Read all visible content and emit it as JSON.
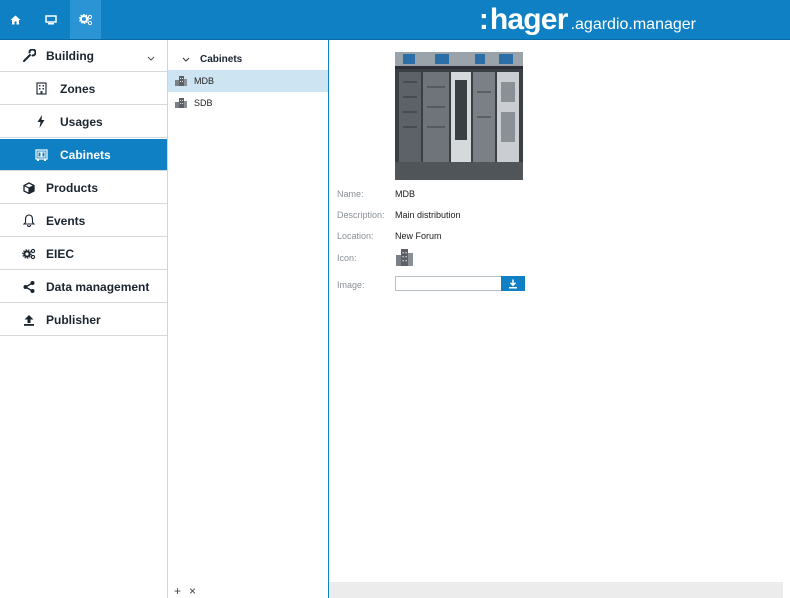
{
  "brand": {
    "colon": ":",
    "name": "hager",
    "product": ".agardio.manager"
  },
  "topbar": {
    "buttons": [
      {
        "icon": "home-icon",
        "active": false
      },
      {
        "icon": "monitor-icon",
        "active": false
      },
      {
        "icon": "settings-gears-icon",
        "active": true
      }
    ]
  },
  "sidebar": {
    "items": [
      {
        "label": "Building",
        "icon": "wrench-icon",
        "expanded": true
      },
      {
        "label": "Zones",
        "icon": "building-icon",
        "sub": true
      },
      {
        "label": "Usages",
        "icon": "lightning-icon",
        "sub": true
      },
      {
        "label": "Cabinets",
        "icon": "cabinet-icon",
        "sub": true,
        "active": true
      },
      {
        "label": "Products",
        "icon": "box-icon"
      },
      {
        "label": "Events",
        "icon": "bell-icon"
      },
      {
        "label": "EIEC",
        "icon": "gears-icon"
      },
      {
        "label": "Data management",
        "icon": "share-icon"
      },
      {
        "label": "Publisher",
        "icon": "upload-icon"
      }
    ]
  },
  "tree": {
    "title": "Cabinets",
    "rows": [
      {
        "label": "MDB",
        "selected": true
      },
      {
        "label": "SDB",
        "selected": false
      }
    ],
    "footer": {
      "add": "+",
      "remove": "×"
    }
  },
  "detail": {
    "fields": {
      "name_label": "Name:",
      "name_value": "MDB",
      "description_label": "Description:",
      "description_value": "Main distribution",
      "location_label": "Location:",
      "location_value": "New Forum",
      "icon_label": "Icon:",
      "image_label": "Image:",
      "image_value": ""
    }
  },
  "colors": {
    "accent": "#0f80c3",
    "selected_row": "#cde4f3"
  }
}
